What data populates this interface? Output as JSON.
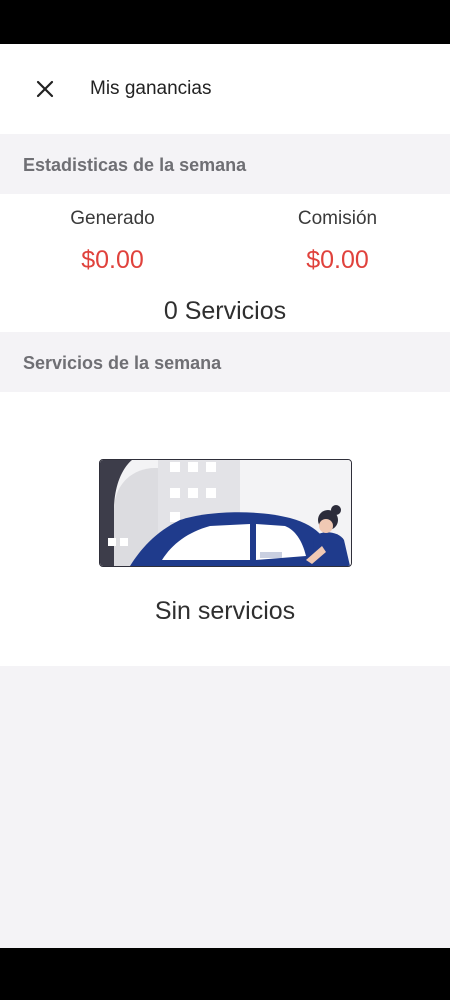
{
  "header": {
    "title": "Mis ganancias",
    "close_icon": "close-icon"
  },
  "weekly_stats": {
    "title": "Estadisticas de la semana",
    "generated_label": "Generado",
    "generated_value": "$0.00",
    "commission_label": "Comisión",
    "commission_value": "$0.00",
    "services_count": "0 Servicios"
  },
  "weekly_services": {
    "title": "Servicios de la semana",
    "empty_text": "Sin servicios",
    "illustration": "car-with-driver-illustration"
  },
  "colors": {
    "accent_red": "#e0423c",
    "car_blue": "#1f3b8c",
    "background": "#f4f3f6"
  }
}
